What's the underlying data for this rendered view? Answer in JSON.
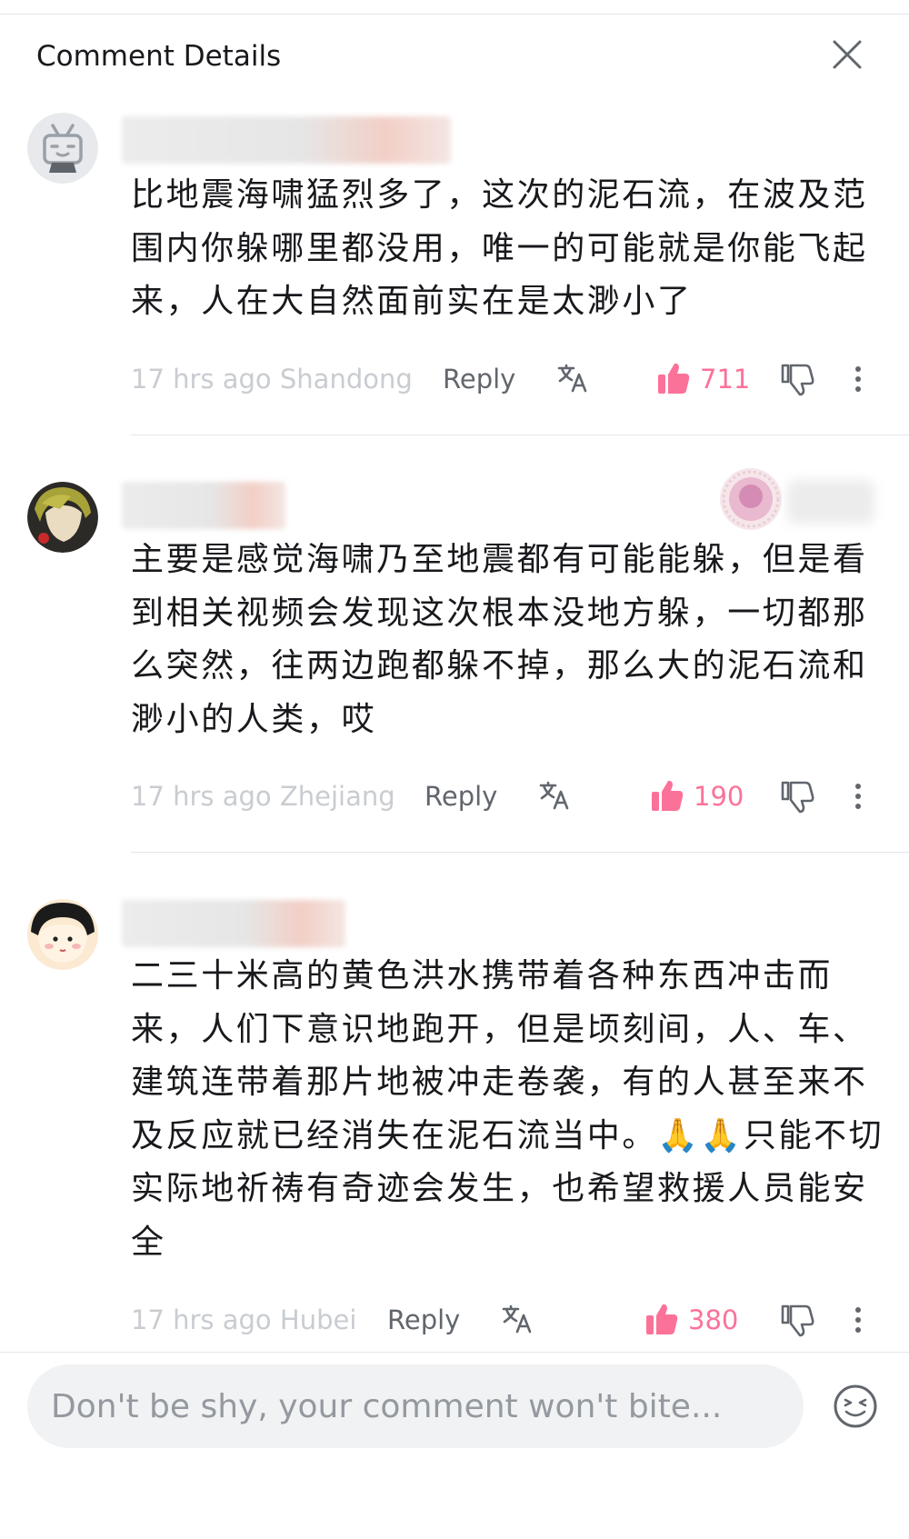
{
  "header": {
    "title": "Comment Details"
  },
  "comments": [
    {
      "text": "比地震海啸猛烈多了，这次的泥石流，在波及范围内你躲哪里都没用，唯一的可能就是你能飞起来，人在大自然面前实在是太渺小了",
      "time_location": "17 hrs ago Shandong",
      "reply_label": "Reply",
      "likes": "711"
    },
    {
      "text": "主要是感觉海啸乃至地震都有可能能躲，但是看到相关视频会发现这次根本没地方躲，一切都那么突然，往两边跑都躲不掉，那么大的泥石流和渺小的人类，哎",
      "time_location": "17 hrs ago Zhejiang",
      "reply_label": "Reply",
      "likes": "190"
    },
    {
      "text": "二三十米高的黄色洪水携带着各种东西冲击而来，人们下意识地跑开，但是顷刻间，人、车、建筑连带着那片地被冲走卷袭，有的人甚至来不及反应就已经消失在泥石流当中。🙏🙏只能不切实际地祈祷有奇迹会发生，也希望救援人员能安全",
      "time_location": "17 hrs ago Hubei",
      "reply_label": "Reply",
      "likes": "380"
    }
  ],
  "composer": {
    "placeholder": "Don't be shy, your comment won't bite..."
  },
  "colors": {
    "accent_pink": "#fb7299",
    "muted": "#c9ccd0",
    "secondary": "#61666d",
    "divider": "#e3e5e7"
  },
  "icons": [
    "close-icon",
    "translate-icon",
    "thumbs-up-icon",
    "thumbs-down-icon",
    "more-vertical-icon",
    "emoji-icon",
    "avatar-tv-icon"
  ]
}
